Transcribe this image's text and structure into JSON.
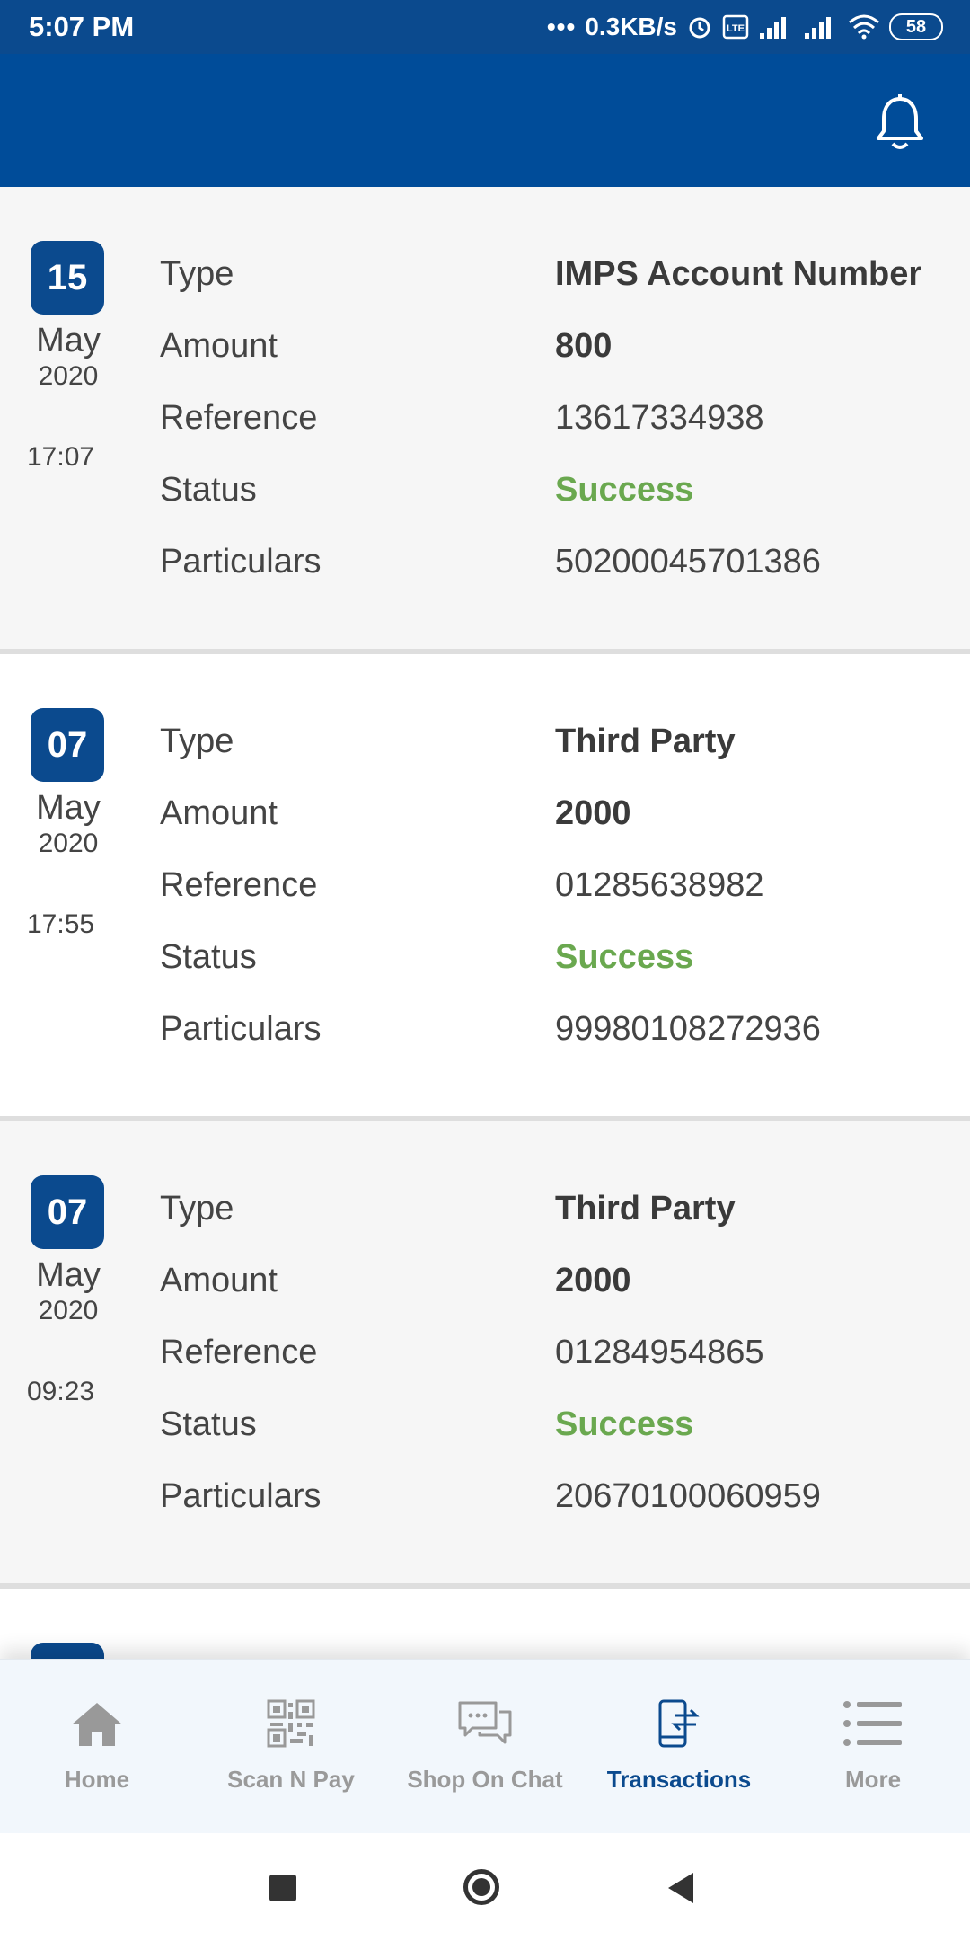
{
  "status_bar": {
    "time": "5:07 PM",
    "network_speed": "0.3KB/s",
    "battery": "58",
    "icons": [
      "alarm-icon",
      "volte-icon",
      "signal-icon",
      "signal-icon",
      "wifi-icon",
      "battery-icon"
    ]
  },
  "app_bar": {
    "notification_icon": "bell-icon"
  },
  "transactions": [
    {
      "day": "15",
      "month": "May",
      "year": "2020",
      "time": "17:07",
      "labels": {
        "type": "Type",
        "amount": "Amount",
        "reference": "Reference",
        "status": "Status",
        "particulars": "Particulars"
      },
      "type": "IMPS Account Number",
      "amount": "800",
      "reference": "13617334938",
      "status": "Success",
      "particulars": "50200045701386"
    },
    {
      "day": "07",
      "month": "May",
      "year": "2020",
      "time": "17:55",
      "labels": {
        "type": "Type",
        "amount": "Amount",
        "reference": "Reference",
        "status": "Status",
        "particulars": "Particulars"
      },
      "type": "Third Party",
      "amount": "2000",
      "reference": "01285638982",
      "status": "Success",
      "particulars": "99980108272936"
    },
    {
      "day": "07",
      "month": "May",
      "year": "2020",
      "time": "09:23",
      "labels": {
        "type": "Type",
        "amount": "Amount",
        "reference": "Reference",
        "status": "Status",
        "particulars": "Particulars"
      },
      "type": "Third Party",
      "amount": "2000",
      "reference": "01284954865",
      "status": "Success",
      "particulars": "20670100060959"
    }
  ],
  "bottom_nav": [
    {
      "label": "Home",
      "icon": "home-icon",
      "active": false
    },
    {
      "label": "Scan N Pay",
      "icon": "qr-code-icon",
      "active": false
    },
    {
      "label": "Shop On Chat",
      "icon": "chat-icon",
      "active": false
    },
    {
      "label": "Transactions",
      "icon": "transactions-icon",
      "active": true
    },
    {
      "label": "More",
      "icon": "menu-list-icon",
      "active": false
    }
  ],
  "colors": {
    "primary": "#004c99",
    "success": "#6aa84f",
    "active_nav": "#0b4a8e",
    "inactive_nav": "#9a9a9a"
  }
}
